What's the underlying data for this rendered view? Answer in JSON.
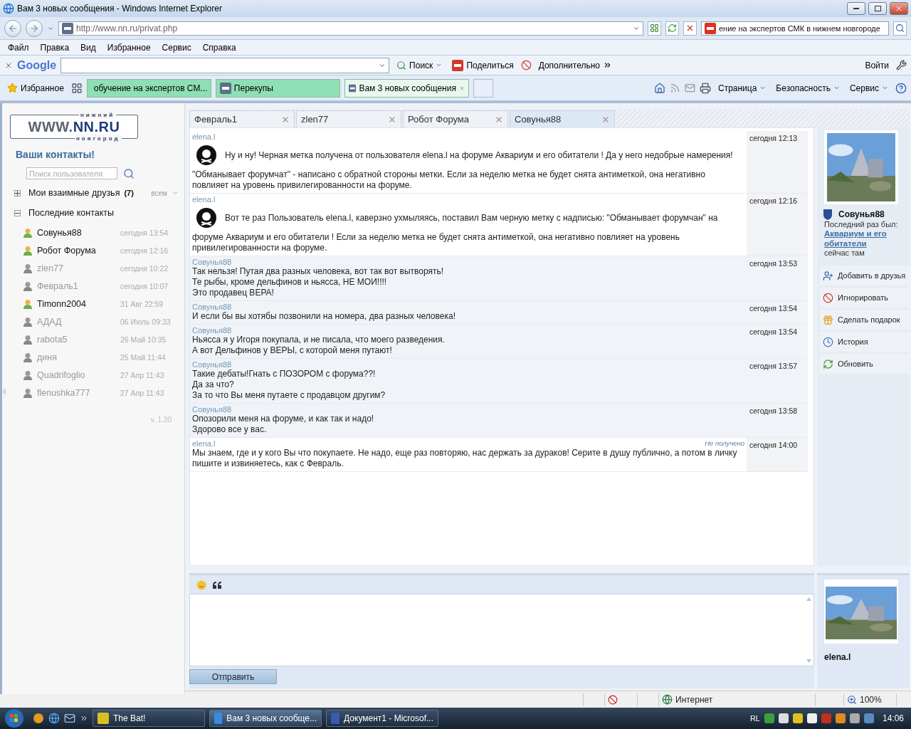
{
  "window": {
    "title": "Вам 3 новых сообщения - Windows Internet Explorer"
  },
  "address_bar": {
    "url": "http://www.nn.ru/privat.php",
    "search": "ение на экспертов СМК в нижнем новгороде"
  },
  "menu": [
    "Файл",
    "Правка",
    "Вид",
    "Избранное",
    "Сервис",
    "Справка"
  ],
  "google_toolbar": {
    "logo": "Google",
    "search_button": "Поиск",
    "share": "Поделиться",
    "more": "Дополнительно",
    "sign_in": "Войти"
  },
  "favorites": {
    "label": "Избранное"
  },
  "browser_tabs": [
    {
      "label": "обучение на экспертов СМ...",
      "selected": false,
      "kind": "yandex"
    },
    {
      "label": "Перекупы",
      "selected": false,
      "kind": "nn"
    },
    {
      "label": "Вам 3 новых сообщения",
      "selected": true,
      "kind": "nn"
    }
  ],
  "command_bar": [
    "Страница",
    "Безопасность",
    "Сервис"
  ],
  "sidebar": {
    "logo": {
      "top": "нижний",
      "left": "WWW.",
      "right": "NN.RU",
      "bottom": "новгород"
    },
    "title": "Ваши контакты!",
    "search": {
      "placeholder": "Поиск пользователя"
    },
    "groups": [
      {
        "label": "Мои взаимные друзья",
        "count": "(7)",
        "filter": "всем",
        "expanded": false
      },
      {
        "label": "Последние контакты",
        "expanded": true,
        "contacts": [
          {
            "name": "Совунья88",
            "time": "сегодня 13:54",
            "online": true
          },
          {
            "name": "Робот Форума",
            "time": "сегодня 12:16",
            "online": true
          },
          {
            "name": "zlen77",
            "time": "сегодня 10:22",
            "online": false
          },
          {
            "name": "Февраль1",
            "time": "сегодня 10:07",
            "online": false
          },
          {
            "name": "Timonn2004",
            "time": "31 Авг 22:59",
            "online": true
          },
          {
            "name": "АДАД",
            "time": "06 Июль 09:33",
            "online": false
          },
          {
            "name": "rabota5",
            "time": "26 Май 10:35",
            "online": false
          },
          {
            "name": "диня",
            "time": "25 Май 11:44",
            "online": false
          },
          {
            "name": "Quadrifoglio",
            "time": "27 Апр 11:43",
            "online": false
          },
          {
            "name": "flenushka777",
            "time": "27 Апр 11:43",
            "online": false
          }
        ]
      }
    ],
    "version": "v. 1.30"
  },
  "chat_tabs": [
    {
      "label": "Февраль1",
      "selected": false
    },
    {
      "label": "zlen77",
      "selected": false
    },
    {
      "label": "Робот Форума",
      "selected": false
    },
    {
      "label": "Совунья88",
      "selected": true
    }
  ],
  "messages": [
    {
      "kind": "mark",
      "author": "elena.l",
      "time": "сегодня 12:13",
      "from_self": true,
      "lead": "Ну и ну! Черная метка получена от пользователя elena.l на форуме Аквариум и его обитатели ! Да у него недобрые намерения!",
      "lines": [
        "\"Обманывает форумчат\" - написано с обратной стороны метки. Если за неделю метка не будет снята антиметкой, она негативно",
        "повлияет на уровень привилегированности на форуме."
      ]
    },
    {
      "kind": "mark",
      "author": "elena.l",
      "time": "сегодня 12:16",
      "from_self": true,
      "lead": "Вот те раз Пользователь elena.l, каверзно ухмыляясь, поставил Вам черную метку с надписью: \"Обманывает форумчан\" на",
      "lines": [
        "форуме Аквариум и его обитатели ! Если за неделю метка не будет снята антиметкой, она негативно повлияет на уровень",
        "привилегированности на форуме."
      ]
    },
    {
      "kind": "plain",
      "author": "Совунья88",
      "time": "сегодня 13:53",
      "from_self": false,
      "lines": [
        "Так нельзя! Путая два разных человека, вот так вот вытворять!",
        "Те рыбы, кроме дельфинов и ньясса, НЕ МОИ!!!!",
        "Это продавец ВЕРА!"
      ]
    },
    {
      "kind": "plain",
      "author": "Совунья88",
      "time": "сегодня 13:54",
      "from_self": false,
      "lines": [
        "И если бы вы хотябы позвонили на номера, два разных человека!"
      ]
    },
    {
      "kind": "plain",
      "author": "Совунья88",
      "time": "сегодня 13:54",
      "from_self": false,
      "lines": [
        "Ньясса я у Игоря покупала, и не писала, что моего разведения.",
        "А вот Дельфинов у ВЕРЫ, с которой меня путают!"
      ]
    },
    {
      "kind": "plain",
      "author": "Совунья88",
      "time": "сегодня 13:57",
      "from_self": false,
      "lines": [
        "Такие дебаты!Гнать с ПОЗОРОМ с форума??!",
        "Да за что?",
        "За то что Вы меня путаете с продавцом другим?"
      ]
    },
    {
      "kind": "plain",
      "author": "Совунья88",
      "time": "сегодня 13:58",
      "from_self": false,
      "lines": [
        "Опозорили меня на форуме, и как так и надо!",
        "Здорово все у вас."
      ]
    },
    {
      "kind": "plain",
      "author": "elena.l",
      "time": "сегодня 14:00",
      "from_self": true,
      "status": "Не получено",
      "lines": [
        "Мы знаем, где и у кого Вы что покупаете. Не надо, еще раз повторяю, нас держать за дураков! Серите в душу публично, а потом в личку",
        "пишите и извиняетесь, как с Февраль."
      ]
    }
  ],
  "profile": {
    "name": "Совунья88",
    "last_seen": "Последний раз был:",
    "place": "Аквариум и его обитатели",
    "status": "сейчас там"
  },
  "actions": [
    {
      "kind": "add-friend",
      "label": "Добавить в друзья"
    },
    {
      "kind": "ignore",
      "label": "Игнорировать"
    },
    {
      "kind": "gift",
      "label": "Сделать подарок"
    },
    {
      "kind": "history",
      "label": "История"
    },
    {
      "kind": "refresh",
      "label": "Обновить"
    }
  ],
  "composer": {
    "send": "Отправить",
    "user": "elena.l"
  },
  "status_bar": {
    "zone": "Интернет",
    "zoom": "100%"
  },
  "taskbar": {
    "tasks": [
      {
        "label": "The Bat!",
        "selected": false
      },
      {
        "label": "Вам 3 новых сообще...",
        "selected": true
      },
      {
        "label": "Документ1 - Microsof...",
        "selected": false
      }
    ],
    "language": "RL",
    "clock": "14:06"
  }
}
